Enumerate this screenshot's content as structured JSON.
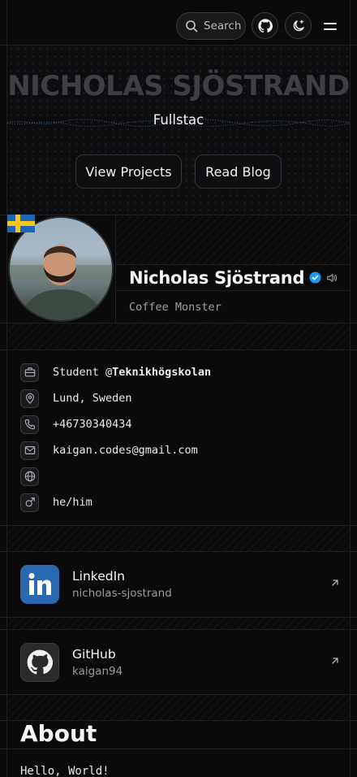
{
  "header": {
    "search_label": "Search",
    "icons": [
      "search-icon",
      "github-icon",
      "theme-toggle-icon",
      "menu-icon"
    ]
  },
  "hero": {
    "name": "NICHOLAS SJÖSTRAND",
    "role": "Fullstac",
    "buttons": [
      "View Projects",
      "Read Blog"
    ]
  },
  "profile": {
    "name": "Nicholas Sjöstrand",
    "title": "Coffee Monster",
    "flag": "Sweden",
    "verified": true
  },
  "info": {
    "work_prefix": "Student @",
    "work_company": "Teknikhögskolan",
    "location": "Lund, Sweden",
    "phone": "+46730340434",
    "email": "kaigan.codes@gmail.com",
    "website": "",
    "pronouns": "he/him"
  },
  "social": [
    {
      "name": "LinkedIn",
      "handle": "nicholas-sjostrand",
      "icon": "linkedin-icon",
      "color": "#2867b2"
    },
    {
      "name": "GitHub",
      "handle": "kaigan94",
      "icon": "github-icon",
      "color": "#2a2a2c"
    }
  ],
  "about": {
    "title": "About",
    "text": "Hello, World!"
  },
  "colors": {
    "background": "#0a0a0b",
    "border": "#1f1f22",
    "verified": "#1d9bf0"
  }
}
